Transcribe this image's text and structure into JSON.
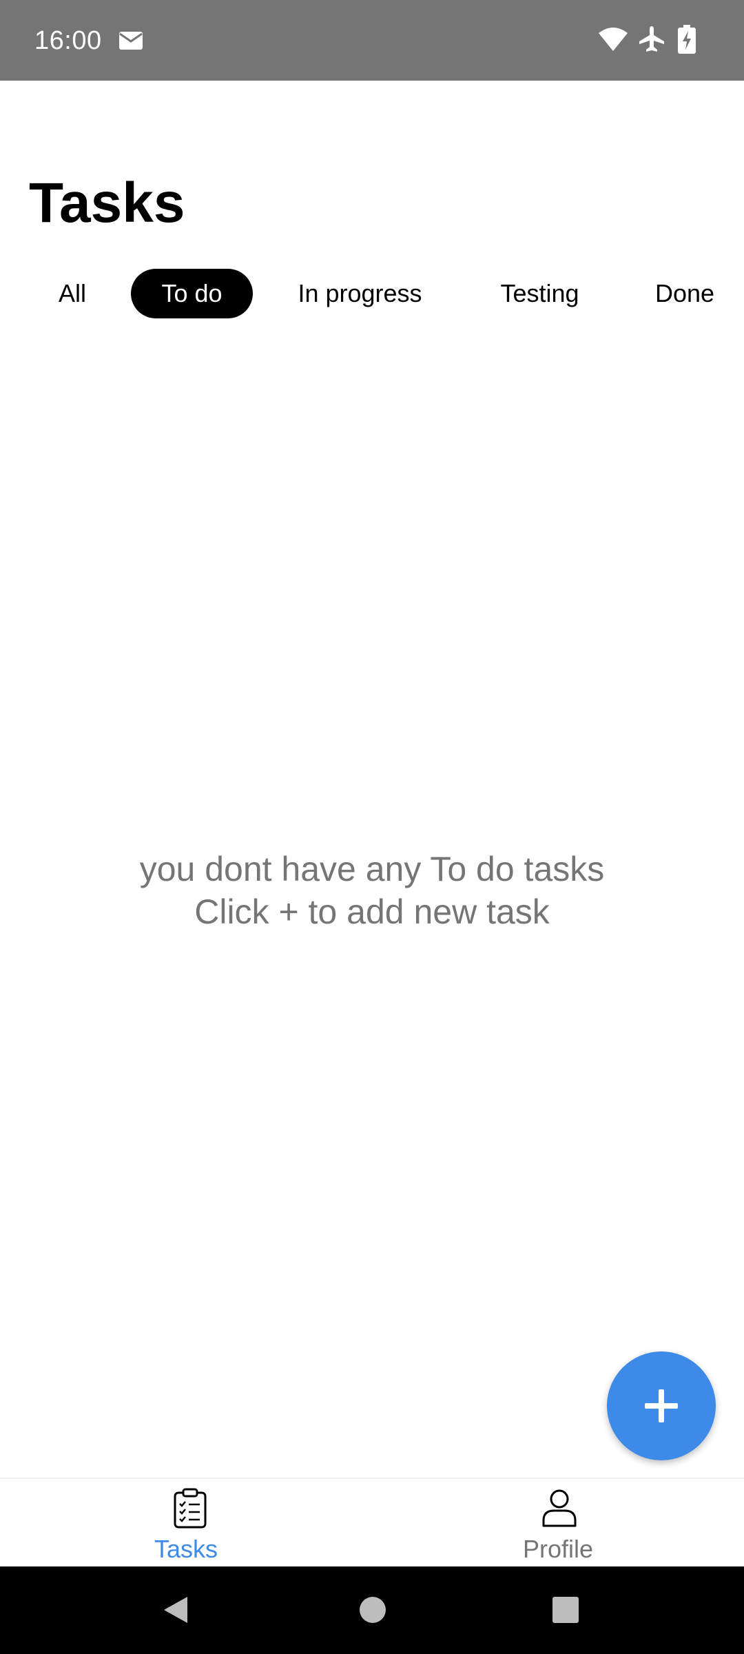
{
  "status_bar": {
    "time": "16:00",
    "icons": [
      "mail-icon",
      "wifi-icon",
      "airplane-mode-icon",
      "battery-charging-icon"
    ]
  },
  "header": {
    "title": "Tasks"
  },
  "filters": {
    "tabs": [
      {
        "label": "All",
        "selected": false
      },
      {
        "label": "To do",
        "selected": true
      },
      {
        "label": "In progress",
        "selected": false
      },
      {
        "label": "Testing",
        "selected": false
      },
      {
        "label": "Done",
        "selected": false
      }
    ]
  },
  "empty_state": {
    "line1": "you dont have any To do tasks",
    "line2": "Click + to add new task"
  },
  "fab": {
    "icon": "plus-icon"
  },
  "bottom_nav": {
    "items": [
      {
        "label": "Tasks",
        "icon": "clipboard-checklist-icon",
        "selected": true
      },
      {
        "label": "Profile",
        "icon": "person-icon",
        "selected": false
      }
    ]
  },
  "system_nav": {
    "icons": [
      "back-icon",
      "home-icon",
      "recents-icon"
    ]
  },
  "colors": {
    "accent": "#3d8ae8",
    "status_bar": "#757575",
    "muted_text": "#757575",
    "active_tab_bg": "#000000"
  }
}
